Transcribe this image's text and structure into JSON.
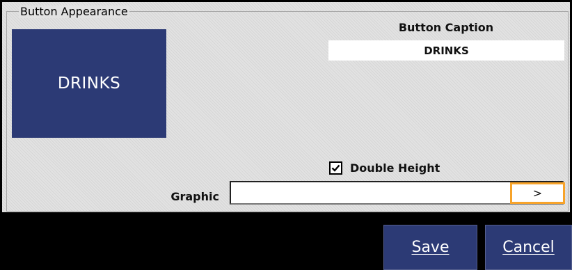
{
  "group": {
    "legend": "Button Appearance"
  },
  "preview": {
    "text": "DRINKS",
    "background_color": "#2c3a75"
  },
  "caption": {
    "label": "Button Caption",
    "value": "DRINKS"
  },
  "double_height": {
    "label": "Double Height",
    "checked": true
  },
  "graphic": {
    "label": "Graphic",
    "value": "",
    "browse_label": ">",
    "focus_color": "#f7a32a"
  },
  "footer": {
    "save_label": "Save",
    "cancel_label": "Cancel",
    "accent_color": "#2c3a75"
  },
  "icons": {
    "checkbox": "checkmark-icon"
  }
}
